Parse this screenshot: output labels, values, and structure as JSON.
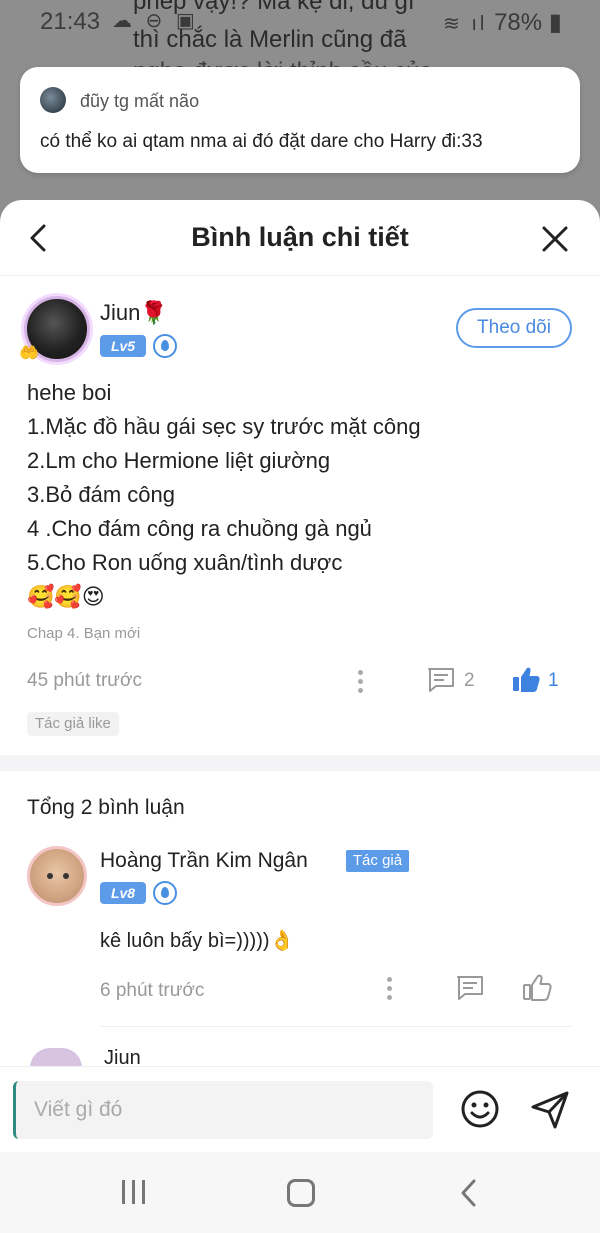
{
  "background": {
    "text_lines": [
      "phép vậy!? Mà kệ đi, dù gì",
      "thì chắc là Merlin cũng đã",
      "nghe được lời thỉnh cầu của"
    ]
  },
  "status_bar": {
    "time": "21:43",
    "battery": "78%"
  },
  "notification": {
    "sender": "đũy tg mất não",
    "message": "có thể ko ai qtam nma ai đó đặt dare cho Harry đi:33"
  },
  "header": {
    "title": "Bình luận chi tiết"
  },
  "main_comment": {
    "author": "Jiun",
    "author_emoji": "🌹",
    "level": "Lv5",
    "follow_label": "Theo dõi",
    "lines": [
      "hehe boi",
      "1.Mặc đồ hầu gái sẹc sy trước mặt công",
      "2.Lm cho Hermione liệt giường",
      "3.Bỏ đám công",
      "4 .Cho đám công ra chuồng gà ngủ",
      "5.Cho Ron uống xuân/tình dược",
      "🥰🥰😍"
    ],
    "chapter": "Chap 4. Bạn mới",
    "time": "45 phút trước",
    "reply_count": "2",
    "like_count": "1",
    "author_like_tag": "Tác giả like"
  },
  "replies_section": {
    "total_label": "Tổng 2 bình luận",
    "replies": [
      {
        "author": "Hoàng Trần Kim Ngân",
        "author_tag": "Tác giả",
        "level": "Lv8",
        "text": "kê luôn bấy bì=)))))👌",
        "time": "6 phút trước"
      }
    ],
    "peek_author": "Jiun"
  },
  "input": {
    "placeholder": "Viết gì đó"
  },
  "colors": {
    "accent": "#5b9be8",
    "like_active": "#3e82e0",
    "muted": "#999999"
  },
  "icons": {
    "back": "chevron-left-icon",
    "close": "close-icon",
    "more": "more-vertical-icon",
    "reply": "comment-icon",
    "like": "thumbs-up-icon",
    "emoji": "smiley-icon",
    "send": "send-icon"
  }
}
